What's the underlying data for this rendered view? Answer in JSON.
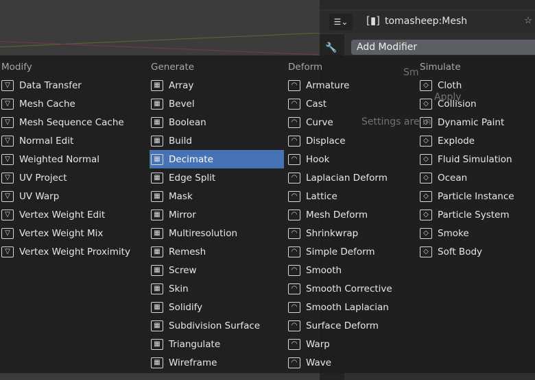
{
  "properties_header": {
    "object_name": "tomasheep:Mesh",
    "add_modifier_label": "Add Modifier"
  },
  "background_fragments": {
    "modifier_name": "Sm",
    "apply": "Apply",
    "settings_note": "Settings are in"
  },
  "colors": {
    "highlight": "#4772b3",
    "menu_bg": "#1e1e1e"
  },
  "menu": {
    "active_item": "Decimate",
    "columns": [
      {
        "title": "Modify",
        "items": [
          "Data Transfer",
          "Mesh Cache",
          "Mesh Sequence Cache",
          "Normal Edit",
          "Weighted Normal",
          "UV Project",
          "UV Warp",
          "Vertex Weight Edit",
          "Vertex Weight Mix",
          "Vertex Weight Proximity"
        ]
      },
      {
        "title": "Generate",
        "items": [
          "Array",
          "Bevel",
          "Boolean",
          "Build",
          "Decimate",
          "Edge Split",
          "Mask",
          "Mirror",
          "Multiresolution",
          "Remesh",
          "Screw",
          "Skin",
          "Solidify",
          "Subdivision Surface",
          "Triangulate",
          "Wireframe"
        ]
      },
      {
        "title": "Deform",
        "items": [
          "Armature",
          "Cast",
          "Curve",
          "Displace",
          "Hook",
          "Laplacian Deform",
          "Lattice",
          "Mesh Deform",
          "Shrinkwrap",
          "Simple Deform",
          "Smooth",
          "Smooth Corrective",
          "Smooth Laplacian",
          "Surface Deform",
          "Warp",
          "Wave"
        ]
      },
      {
        "title": "Simulate",
        "items": [
          "Cloth",
          "Collision",
          "Dynamic Paint",
          "Explode",
          "Fluid Simulation",
          "Ocean",
          "Particle Instance",
          "Particle System",
          "Smoke",
          "Soft Body"
        ]
      }
    ]
  }
}
